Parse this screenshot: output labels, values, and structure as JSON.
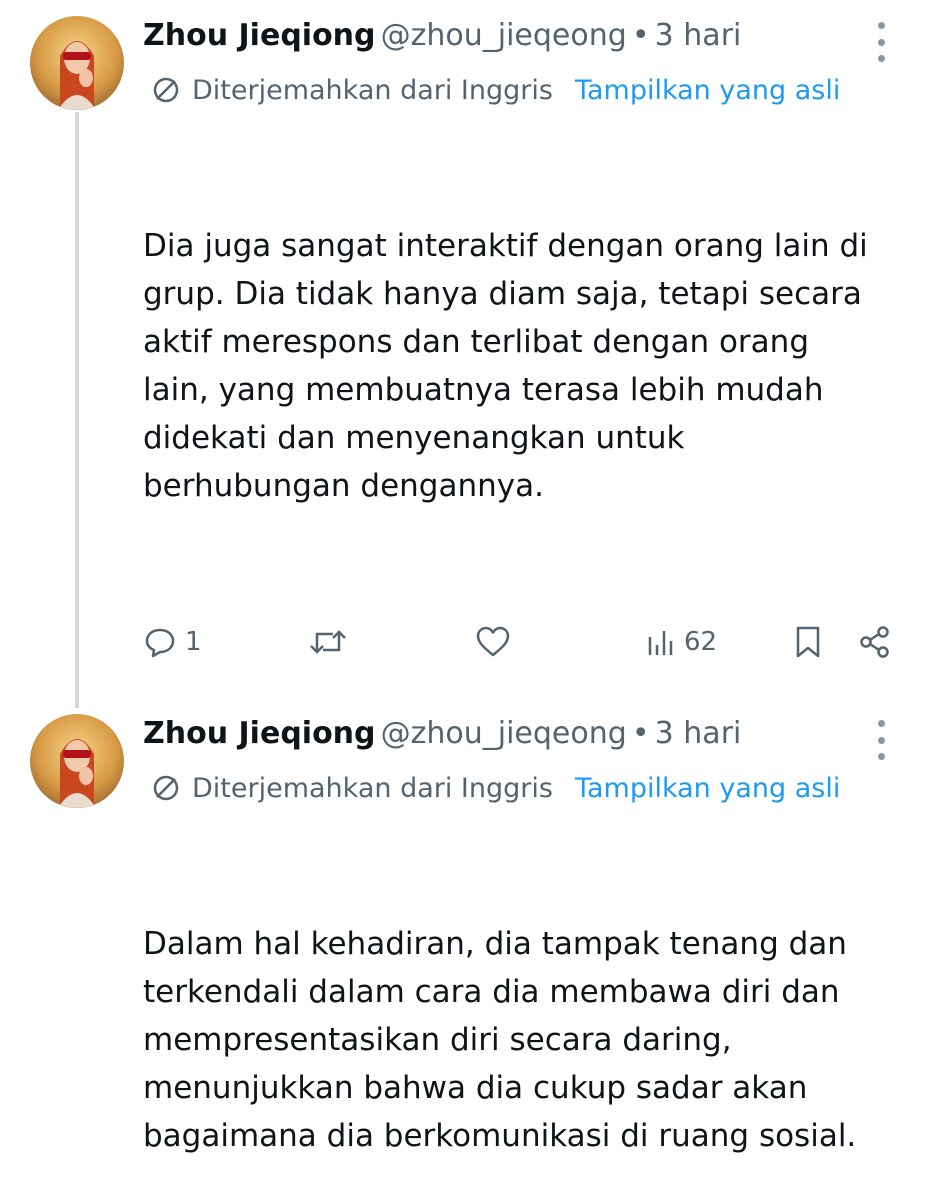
{
  "tweets": [
    {
      "author": {
        "name": "Zhou Jieqiong",
        "handle": "@zhou_jieqeong",
        "separator": "•",
        "time": "3 hari",
        "avatar_icon": "profile-photo"
      },
      "translation": {
        "source_label": "Diterjemahkan dari Inggris",
        "show_original": "Tampilkan yang asli",
        "icon": "translate-icon"
      },
      "text": "Dia juga sangat interaktif dengan orang lain di grup. Dia tidak hanya diam saja, tetapi secara aktif merespons dan terlibat dengan orang lain, yang membuatnya terasa lebih mudah didekati dan menyenangkan untuk berhubungan dengannya.",
      "actions": {
        "replies": "1",
        "views": "62"
      }
    },
    {
      "author": {
        "name": "Zhou Jieqiong",
        "handle": "@zhou_jieqeong",
        "separator": "•",
        "time": "3 hari",
        "avatar_icon": "profile-photo"
      },
      "translation": {
        "source_label": "Diterjemahkan dari Inggris",
        "show_original": "Tampilkan yang asli",
        "icon": "translate-icon"
      },
      "text": "Dalam hal kehadiran, dia tampak tenang dan terkendali dalam cara dia membawa diri dan mempresentasikan diri secara daring, menunjukkan bahwa dia cukup sadar akan bagaimana dia berkomunikasi di ruang sosial."
    }
  ],
  "colors": {
    "text": "#0f1419",
    "secondary": "#536471",
    "link": "#1d9bf0",
    "thread_line": "#cfd9de"
  }
}
